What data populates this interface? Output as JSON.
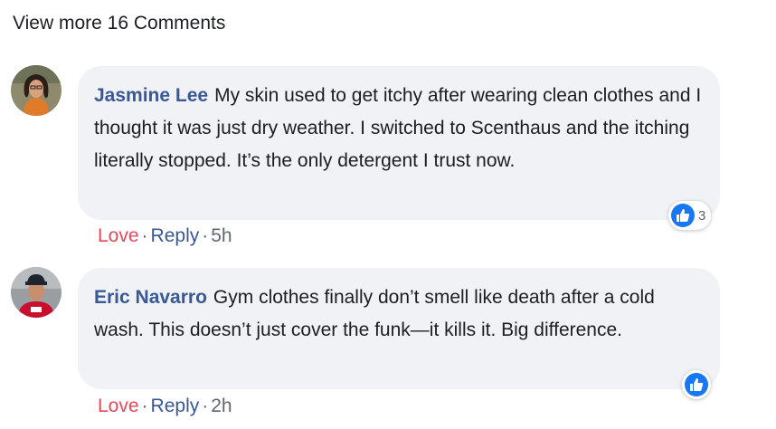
{
  "view_more_label": "View more 16 Comments",
  "comments": [
    {
      "author": "Jasmine Lee",
      "text": "My skin used to get itchy after wearing clean clothes and I thought it was just dry weather. I switched to Scenthaus and the itching literally stopped. It’s the only detergent I trust now.",
      "reaction_icon": "like-icon",
      "reaction_count": "3",
      "love_label": "Love",
      "reply_label": "Reply",
      "time": "5h"
    },
    {
      "author": "Eric Navarro",
      "text": "Gym clothes finally don’t smell like death after a cold wash. This doesn’t just cover the funk—it kills it. Big difference.",
      "reaction_icon": "like-icon",
      "reaction_count": "",
      "love_label": "Love",
      "reply_label": "Reply",
      "time": "2h"
    }
  ],
  "colors": {
    "author": "#385898",
    "love": "#e9465a",
    "bubble": "#f0f2f5",
    "like": "#1877f2"
  }
}
